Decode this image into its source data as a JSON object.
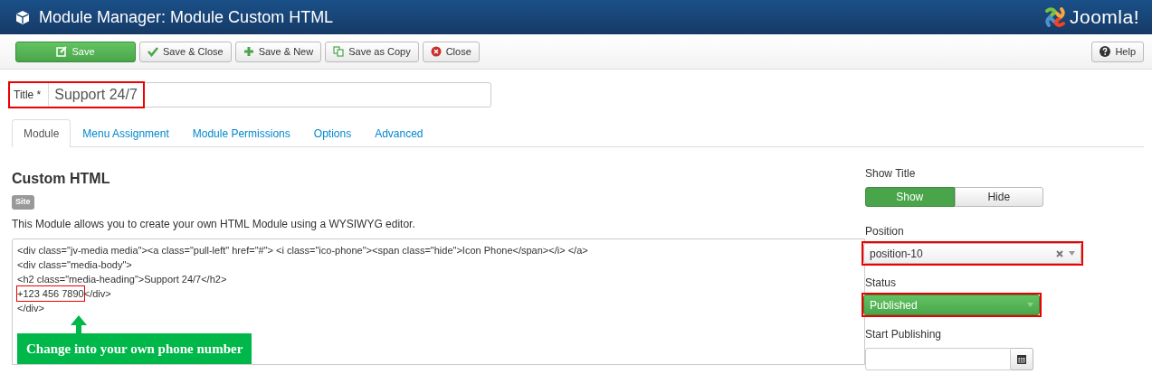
{
  "header": {
    "title": "Module Manager: Module Custom HTML",
    "logo_text": "Joomla!"
  },
  "toolbar": {
    "buttons": [
      {
        "label": "Save",
        "kind": "save"
      },
      {
        "label": "Save & Close",
        "kind": "check"
      },
      {
        "label": "Save & New",
        "kind": "plus"
      },
      {
        "label": "Save as Copy",
        "kind": "copy"
      },
      {
        "label": "Close",
        "kind": "close"
      }
    ],
    "help": {
      "label": "Help"
    }
  },
  "title_field": {
    "label": "Title *",
    "value": "Support 24/7",
    "highlighted": true
  },
  "tabs": [
    {
      "label": "Module",
      "selected": true
    },
    {
      "label": "Menu Assignment",
      "selected": false
    },
    {
      "label": "Module Permissions",
      "selected": false
    },
    {
      "label": "Options",
      "selected": false
    },
    {
      "label": "Advanced",
      "selected": false
    }
  ],
  "module": {
    "heading": "Custom HTML",
    "badge": "Site",
    "description": "This Module allows you to create your own HTML Module using a WYSIWYG editor.",
    "code_lines": [
      [
        {
          "text": "<div class=\"jv-media media\"><a class=\"pull-left\" href=\"#\"> <i class=\"ico-phone\"><span class=\"hide\">Icon Phone</span></i> </a>",
          "highlighted": false
        }
      ],
      [
        {
          "text": "<div class=\"media-body\">",
          "highlighted": false
        }
      ],
      [
        {
          "text": "<h2 class=\"media-heading\">Support 24/7</h2>",
          "highlighted": false
        }
      ],
      [
        {
          "text": "+123 456 7890",
          "highlighted": true
        },
        {
          "text": "</div>",
          "highlighted": false
        }
      ],
      [
        {
          "text": "</div>",
          "highlighted": false
        }
      ]
    ],
    "annotation": {
      "text": "Change into your own phone number"
    }
  },
  "show_title": {
    "label": "Show Title",
    "options": [
      {
        "label": "Show",
        "selected": true
      },
      {
        "label": "Hide",
        "selected": false
      }
    ]
  },
  "position": {
    "label": "Position",
    "value": "position-10",
    "highlighted": true
  },
  "status": {
    "label": "Status",
    "value": "Published",
    "highlighted": true
  },
  "start_publishing": {
    "label": "Start Publishing"
  }
}
